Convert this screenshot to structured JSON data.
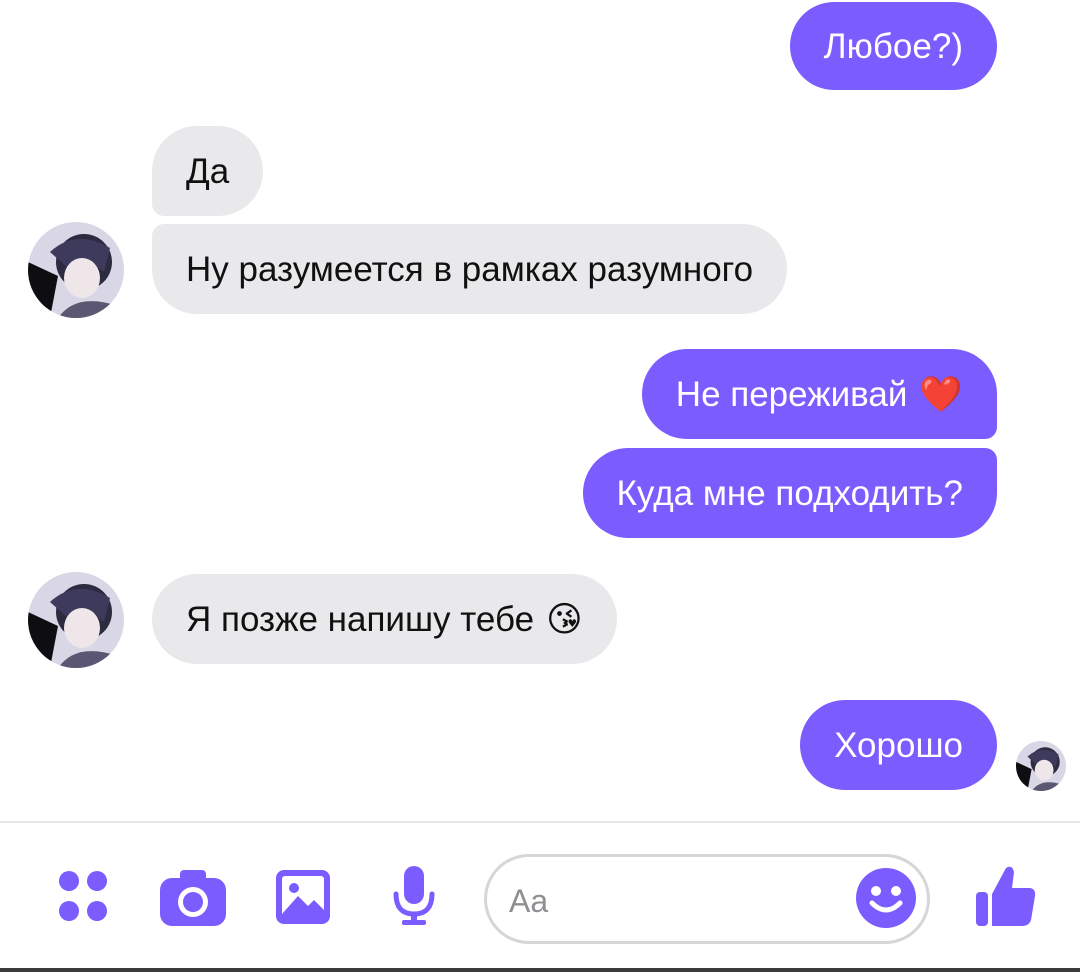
{
  "conversation": {
    "messages": [
      {
        "sender": "me",
        "text": "Любое?)"
      },
      {
        "sender": "them",
        "text": "Да"
      },
      {
        "sender": "them",
        "text": "Ну разумеется в рамках разумного"
      },
      {
        "sender": "me",
        "text": "Не переживай",
        "emoji": "❤️"
      },
      {
        "sender": "me",
        "text": "Куда мне подходить?"
      },
      {
        "sender": "them",
        "text": "Я позже напишу тебе",
        "emoji": "😘"
      },
      {
        "sender": "me",
        "text": "Хорошо"
      }
    ]
  },
  "composer": {
    "placeholder": "Aa",
    "icons": {
      "menu": "apps-dots-icon",
      "camera": "camera-icon",
      "gallery": "image-icon",
      "voice": "microphone-icon",
      "emoji": "smiley-icon",
      "like": "thumbs-up-icon"
    }
  },
  "colors": {
    "accent": "#7b5cff",
    "incoming_bubble": "#e9e9ec",
    "outgoing_text": "#ffffff",
    "incoming_text": "#111111"
  }
}
